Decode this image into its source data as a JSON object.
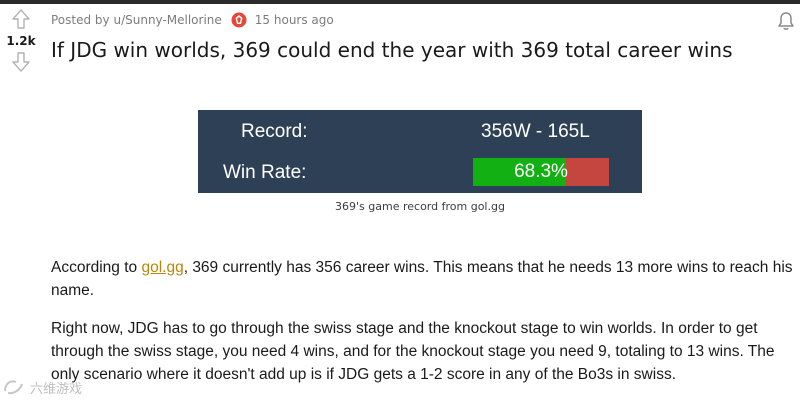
{
  "vote": {
    "score": "1.2k"
  },
  "post": {
    "posted_prefix": "Posted by",
    "author": "u/Sunny-Mellorine",
    "time": "15 hours ago",
    "title": "If JDG win worlds, 369 could end the year with 369 total career wins"
  },
  "image": {
    "record_label": "Record:",
    "record_value": "356W - 165L",
    "winrate_label": "Win Rate:",
    "winrate_value": "68.3%",
    "winrate_fraction": 0.683,
    "caption": "369's game record from gol.gg"
  },
  "body": {
    "p1_before_link": "According to ",
    "p1_link": "gol.gg",
    "p1_after_link": ", 369 currently has 356 career wins. This means that he needs 13 more wins to reach his name.",
    "p2": "Right now, JDG has to go through the swiss stage and the knockout stage to win worlds. In order to get through the swiss stage, you need 4 wins, and for the knockout stage you need 9, totaling to 13 wins. The only scenario where it doesn't add up is if JDG gets a 1-2 score in any of the Bo3s in swiss."
  },
  "watermark": {
    "text": "六维游戏"
  },
  "colors": {
    "statbox_bg": "#2e4056",
    "win_green": "#12b012",
    "loss_red": "#c5453f",
    "link": "#b8860b"
  }
}
